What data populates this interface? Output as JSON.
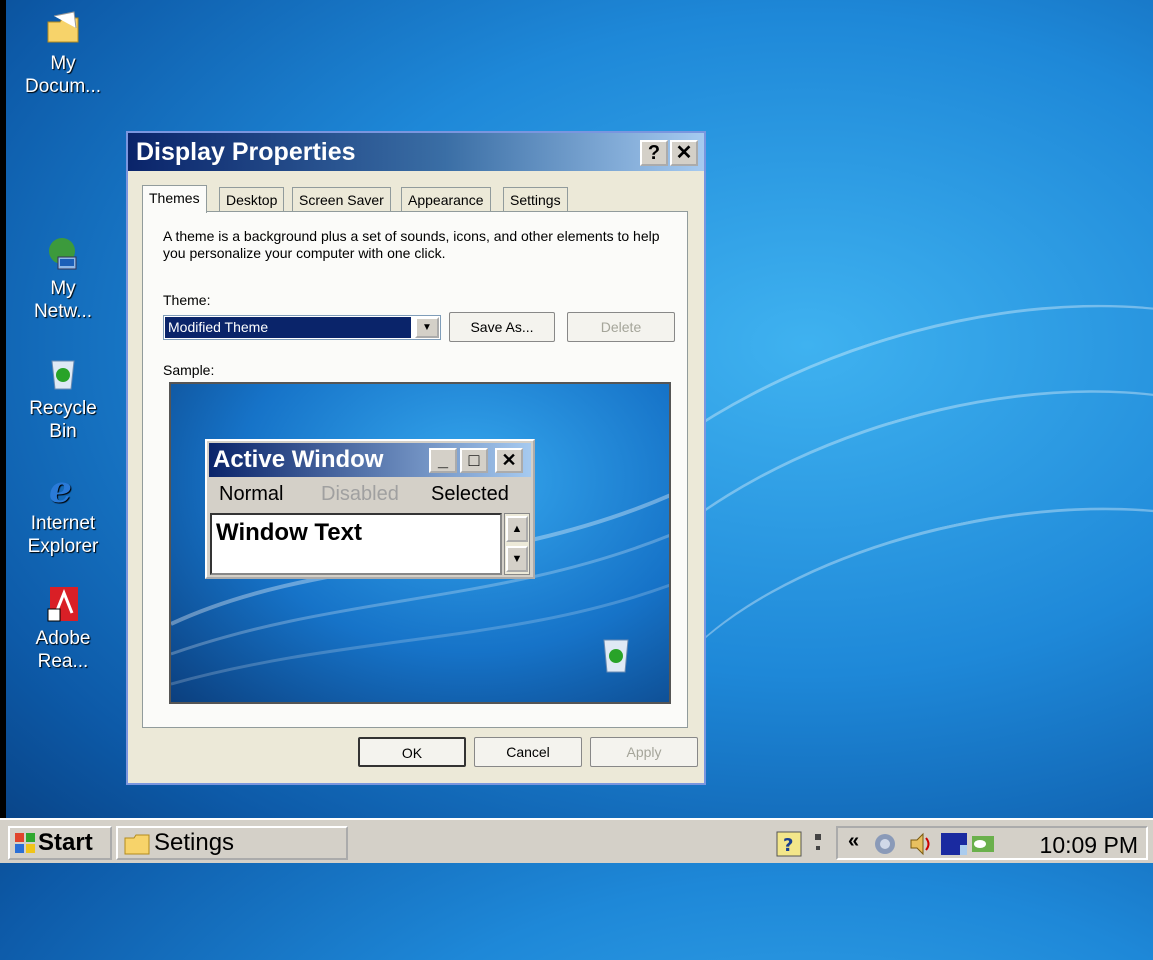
{
  "desktop": {
    "icons": [
      {
        "label": "My\nDocum...",
        "icon": "my-documents-icon"
      },
      {
        "label": "My\nNetw...",
        "icon": "network-icon"
      },
      {
        "label": "Recycle\nBin",
        "icon": "recycle-bin-icon"
      },
      {
        "label": "Internet\nExplorer",
        "icon": "internet-explorer-icon"
      },
      {
        "label": "Adobe\nRea...",
        "icon": "adobe-reader-icon"
      }
    ]
  },
  "dialog": {
    "title": "Display Properties",
    "help_label": "?",
    "close_label": "✕",
    "tabs": [
      "Themes",
      "Desktop",
      "Screen Saver",
      "Appearance",
      "Settings"
    ],
    "active_tab": "Themes",
    "description": "A theme is a background plus a set of sounds, icons, and other elements to help you personalize your computer with one click.",
    "theme_label": "Theme:",
    "theme_value": "Modified Theme",
    "save_as_label": "Save As...",
    "delete_label": "Delete",
    "sample_label": "Sample:",
    "sample": {
      "window_title": "Active Window",
      "min_label": "_",
      "max_label": "□",
      "close_label": "✕",
      "menu": [
        "Normal",
        "Disabled",
        "Selected"
      ],
      "window_text": "Window Text"
    },
    "ok_label": "OK",
    "cancel_label": "Cancel",
    "apply_label": "Apply"
  },
  "taskbar": {
    "start_label": "Start",
    "task_label": "Setings",
    "clock": "10:09 PM"
  },
  "colors": {
    "title_dark": "#0a246a",
    "title_light": "#a6caf0",
    "dialog_bg": "#ece9d8",
    "desktop_blue": "#1e88d8"
  }
}
